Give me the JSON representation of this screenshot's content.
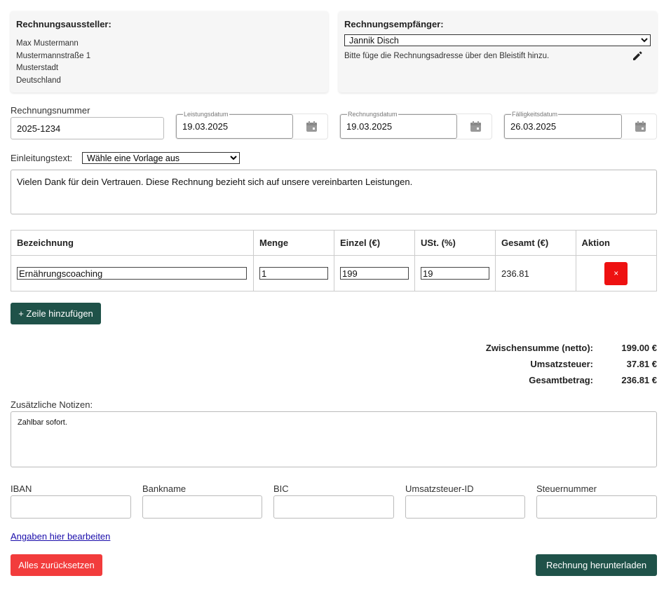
{
  "sender": {
    "title": "Rechnungsaussteller:",
    "lines": [
      "Max Mustermann",
      "Mustermannstraße 1",
      "Musterstadt",
      "Deutschland"
    ]
  },
  "recipient": {
    "title": "Rechnungsempfänger:",
    "selected": "Jannik Disch",
    "hint": "Bitte füge die Rechnungsadresse über den Bleistift hinzu.",
    "edit_icon": "pencil-icon"
  },
  "invoice": {
    "number_label": "Rechnungsnummer",
    "number_value": "2025-1234",
    "service_date_label": "Leistungsdatum",
    "service_date_value": "19.03.2025",
    "invoice_date_label": "Rechnungsdatum",
    "invoice_date_value": "19.03.2025",
    "due_date_label": "Fälligkeitsdatum",
    "due_date_value": "26.03.2025",
    "calendar_icon": "calendar-icon"
  },
  "intro": {
    "label": "Einleitungstext:",
    "template_select": "Wähle eine Vorlage aus",
    "text": "Vielen Dank für dein Vertrauen. Diese Rechnung bezieht sich auf unsere vereinbarten Leistungen."
  },
  "table": {
    "headers": [
      "Bezeichnung",
      "Menge",
      "Einzel (€)",
      "USt. (%)",
      "Gesamt (€)",
      "Aktion"
    ],
    "rows": [
      {
        "description": "Ernährungscoaching",
        "quantity": "1",
        "unit_price": "199",
        "vat": "19",
        "total": "236.81",
        "delete_label": "×"
      }
    ]
  },
  "add_row_label": "+ Zeile hinzufügen",
  "totals": {
    "subtotal_label": "Zwischensumme (netto):",
    "subtotal_value": "199.00 €",
    "vat_label": "Umsatzsteuer:",
    "vat_value": "37.81 €",
    "total_label": "Gesamtbetrag:",
    "total_value": "236.81 €"
  },
  "notes": {
    "label": "Zusätzliche Notizen:",
    "text": "Zahlbar sofort."
  },
  "bank": {
    "iban_label": "IBAN",
    "bankname_label": "Bankname",
    "bic_label": "BIC",
    "vat_id_label": "Umsatzsteuer-ID",
    "tax_number_label": "Steuernummer"
  },
  "edit_link": "Angaben hier bearbeiten",
  "reset_label": "Alles zurücksetzen",
  "download_label": "Rechnung herunterladen",
  "colors": {
    "primary": "#1f5249",
    "danger": "#ee1111",
    "reset": "#f23c3c",
    "link": "#1a0dab"
  }
}
